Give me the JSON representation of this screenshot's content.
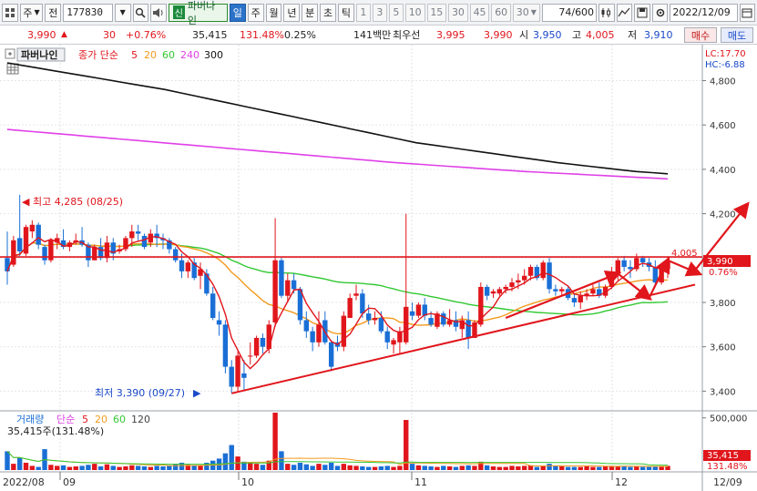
{
  "toolbar": {
    "type_label": "주",
    "prev_label": "전",
    "code": "177830",
    "new_badge": "신",
    "stock_name": "파버나인",
    "periods": [
      "일",
      "주",
      "월",
      "년",
      "분",
      "초",
      "틱"
    ],
    "active_period": "일",
    "numbers": [
      "1",
      "3",
      "5",
      "10",
      "15",
      "30",
      "45",
      "60"
    ],
    "period_count": "30",
    "count_display": "74/600",
    "date": "2022/12/09"
  },
  "info": {
    "price": "3,990",
    "change": "30",
    "change_rate": "+0.76%",
    "volume": "35,415",
    "volume_rate": "131.48%",
    "turnover_rate": "0.25%",
    "amount": "141백만",
    "best_bid_label": "최우선",
    "best_ask": "3,995",
    "best_bid": "3,990",
    "open_label": "시",
    "open": "3,950",
    "high_label": "고",
    "high": "4,005",
    "low_label": "저",
    "low": "3,910",
    "buy_label": "매수",
    "sell_label": "매도"
  },
  "legend": {
    "name": "파버나인",
    "ma_label": "종가 단순",
    "ma_periods": [
      "5",
      "20",
      "60",
      "240",
      "300"
    ],
    "vol_label": "거래량",
    "vol_ma_label": "단순",
    "vol_ma_periods": [
      "5",
      "20",
      "60",
      "120"
    ],
    "vol_info": "35,415주(131.48%)",
    "lc": "LC:17.70",
    "hc": "HC:-6.88"
  },
  "annotations": {
    "high_label": "최고 4,285 (08/25)",
    "low_label": "최저 3,390 (09/27)",
    "resistance_label": "4,005",
    "price_tag": "3,990",
    "pct_tag": "0.76%",
    "vol_tag": "35,415",
    "vol_pct_tag": "131.48%"
  },
  "colors": {
    "up": "#e0161c",
    "down": "#1a6fd6",
    "ma5": "#e0161c",
    "ma20": "#f39a1d",
    "ma60": "#32c832",
    "ma240": "#e040e8",
    "ma300": "#111111",
    "arrow": "#e0161c"
  },
  "chart_data": {
    "type": "candlestick",
    "price_axis": {
      "ticks": [
        "4,800",
        "4,600",
        "4,400",
        "4,200",
        "4,000",
        "3,800",
        "3,600",
        "3,400"
      ]
    },
    "volume_axis": {
      "ticks": [
        "500,000"
      ]
    },
    "x_ticks": [
      "2022/08",
      "09",
      "10",
      "11",
      "12",
      "12/09"
    ],
    "candles": [
      [
        4000,
        4120,
        3880,
        3940
      ],
      [
        3970,
        4100,
        3960,
        4080
      ],
      [
        4090,
        4285,
        4010,
        4030
      ],
      [
        4020,
        4150,
        4010,
        4140
      ],
      [
        4120,
        4170,
        4090,
        4150
      ],
      [
        4150,
        4160,
        4040,
        4060
      ],
      [
        4050,
        4060,
        3970,
        3990
      ],
      [
        3990,
        4090,
        3980,
        4080
      ],
      [
        4070,
        4110,
        4040,
        4090
      ],
      [
        4080,
        4130,
        4040,
        4050
      ],
      [
        4050,
        4080,
        4030,
        4070
      ],
      [
        4070,
        4110,
        4060,
        4080
      ],
      [
        4080,
        4140,
        4050,
        4060
      ],
      [
        4060,
        4070,
        3960,
        3990
      ],
      [
        3990,
        4060,
        3990,
        4050
      ],
      [
        4050,
        4090,
        3990,
        4000
      ],
      [
        4000,
        4100,
        3980,
        4070
      ],
      [
        4070,
        4090,
        3990,
        4020
      ],
      [
        4030,
        4060,
        4020,
        4040
      ],
      [
        4040,
        4100,
        4030,
        4090
      ],
      [
        4090,
        4150,
        4050,
        4120
      ],
      [
        4120,
        4150,
        4080,
        4110
      ],
      [
        4100,
        4110,
        4040,
        4050
      ],
      [
        4070,
        4130,
        4050,
        4110
      ],
      [
        4110,
        4150,
        4050,
        4090
      ],
      [
        4090,
        4110,
        4040,
        4080
      ],
      [
        4080,
        4090,
        4020,
        4040
      ],
      [
        4040,
        4050,
        3980,
        3990
      ],
      [
        3990,
        4020,
        3910,
        3940
      ],
      [
        3940,
        3990,
        3910,
        3980
      ],
      [
        3980,
        4000,
        3900,
        3910
      ],
      [
        3920,
        3980,
        3860,
        3950
      ],
      [
        3930,
        3950,
        3830,
        3840
      ],
      [
        3840,
        3870,
        3720,
        3730
      ],
      [
        3720,
        3760,
        3650,
        3700
      ],
      [
        3700,
        3720,
        3480,
        3510
      ],
      [
        3510,
        3540,
        3390,
        3420
      ],
      [
        3420,
        3580,
        3400,
        3560
      ],
      [
        3480,
        3540,
        3400,
        3460
      ],
      [
        3560,
        3620,
        3520,
        3560
      ],
      [
        3560,
        3650,
        3550,
        3640
      ],
      [
        3640,
        3660,
        3570,
        3600
      ],
      [
        3590,
        3720,
        3570,
        3700
      ],
      [
        3710,
        4180,
        3690,
        3990
      ],
      [
        3990,
        4000,
        3820,
        3830
      ],
      [
        3830,
        3930,
        3800,
        3900
      ],
      [
        3900,
        3930,
        3840,
        3860
      ],
      [
        3860,
        3870,
        3700,
        3720
      ],
      [
        3720,
        3760,
        3640,
        3670
      ],
      [
        3670,
        3690,
        3580,
        3620
      ],
      [
        3620,
        3760,
        3600,
        3700
      ],
      [
        3720,
        3760,
        3610,
        3620
      ],
      [
        3620,
        3630,
        3490,
        3510
      ],
      [
        3620,
        3650,
        3580,
        3600
      ],
      [
        3600,
        3760,
        3580,
        3740
      ],
      [
        3730,
        3840,
        3730,
        3820
      ],
      [
        3830,
        3880,
        3810,
        3840
      ],
      [
        3840,
        3860,
        3730,
        3750
      ],
      [
        3750,
        3790,
        3700,
        3720
      ],
      [
        3720,
        3760,
        3700,
        3730
      ],
      [
        3730,
        3760,
        3660,
        3670
      ],
      [
        3670,
        3690,
        3590,
        3620
      ],
      [
        3610,
        3640,
        3570,
        3630
      ],
      [
        3620,
        3690,
        3570,
        3670
      ],
      [
        3620,
        4200,
        3610,
        3780
      ],
      [
        3760,
        3800,
        3720,
        3740
      ],
      [
        3740,
        3800,
        3730,
        3790
      ],
      [
        3790,
        3820,
        3720,
        3740
      ],
      [
        3730,
        3760,
        3690,
        3700
      ],
      [
        3690,
        3760,
        3680,
        3750
      ],
      [
        3750,
        3760,
        3690,
        3700
      ],
      [
        3700,
        3770,
        3690,
        3720
      ],
      [
        3720,
        3760,
        3670,
        3690
      ],
      [
        3680,
        3740,
        3640,
        3720
      ],
      [
        3720,
        3760,
        3590,
        3640
      ],
      [
        3640,
        3720,
        3640,
        3710
      ],
      [
        3700,
        3890,
        3690,
        3870
      ],
      [
        3870,
        3880,
        3810,
        3830
      ],
      [
        3840,
        3860,
        3820,
        3850
      ],
      [
        3840,
        3870,
        3830,
        3860
      ],
      [
        3860,
        3880,
        3840,
        3870
      ],
      [
        3870,
        3910,
        3850,
        3890
      ],
      [
        3890,
        3930,
        3860,
        3900
      ],
      [
        3900,
        3950,
        3880,
        3920
      ],
      [
        3920,
        3970,
        3900,
        3960
      ],
      [
        3960,
        3970,
        3900,
        3910
      ],
      [
        3910,
        3990,
        3900,
        3980
      ],
      [
        3980,
        4000,
        3840,
        3860
      ],
      [
        3860,
        3880,
        3830,
        3850
      ],
      [
        3850,
        3870,
        3830,
        3860
      ],
      [
        3860,
        3870,
        3810,
        3820
      ],
      [
        3820,
        3840,
        3780,
        3800
      ],
      [
        3800,
        3850,
        3770,
        3830
      ],
      [
        3830,
        3860,
        3810,
        3840
      ],
      [
        3840,
        3880,
        3830,
        3860
      ],
      [
        3860,
        3890,
        3820,
        3830
      ],
      [
        3830,
        3880,
        3820,
        3870
      ],
      [
        3870,
        3960,
        3860,
        3930
      ],
      [
        3930,
        4000,
        3900,
        3990
      ],
      [
        3990,
        4010,
        3940,
        3960
      ],
      [
        3960,
        3990,
        3910,
        3950
      ],
      [
        3950,
        4020,
        3940,
        4000
      ],
      [
        4000,
        4010,
        3960,
        3980
      ],
      [
        3980,
        4000,
        3940,
        3960
      ],
      [
        3960,
        3990,
        3880,
        3890
      ],
      [
        3890,
        3960,
        3880,
        3950
      ],
      [
        3950,
        4005,
        3910,
        3990
      ]
    ],
    "ma240": [
      4580,
      4575,
      4570,
      4565,
      4560,
      4555,
      4550,
      4545,
      4540,
      4535,
      4530,
      4525,
      4520,
      4515,
      4510,
      4505,
      4500,
      4495,
      4490,
      4485,
      4480,
      4475,
      4470,
      4465,
      4460,
      4455,
      4450,
      4445,
      4440,
      4435,
      4430,
      4426,
      4422,
      4418,
      4414,
      4410,
      4406,
      4402,
      4398,
      4394,
      4390,
      4387,
      4384,
      4381,
      4378,
      4375,
      4372,
      4369,
      4366,
      4363,
      4360,
      4357
    ],
    "ma300": [
      4880,
      4868,
      4856,
      4844,
      4832,
      4820,
      4808,
      4796,
      4784,
      4772,
      4760,
      4745,
      4730,
      4715,
      4700,
      4685,
      4670,
      4655,
      4640,
      4625,
      4610,
      4595,
      4580,
      4565,
      4550,
      4535,
      4520,
      4510,
      4500,
      4490,
      4480,
      4470,
      4460,
      4450,
      4440,
      4430,
      4422,
      4414,
      4406,
      4398,
      4390,
      4385,
      4380
    ]
  }
}
